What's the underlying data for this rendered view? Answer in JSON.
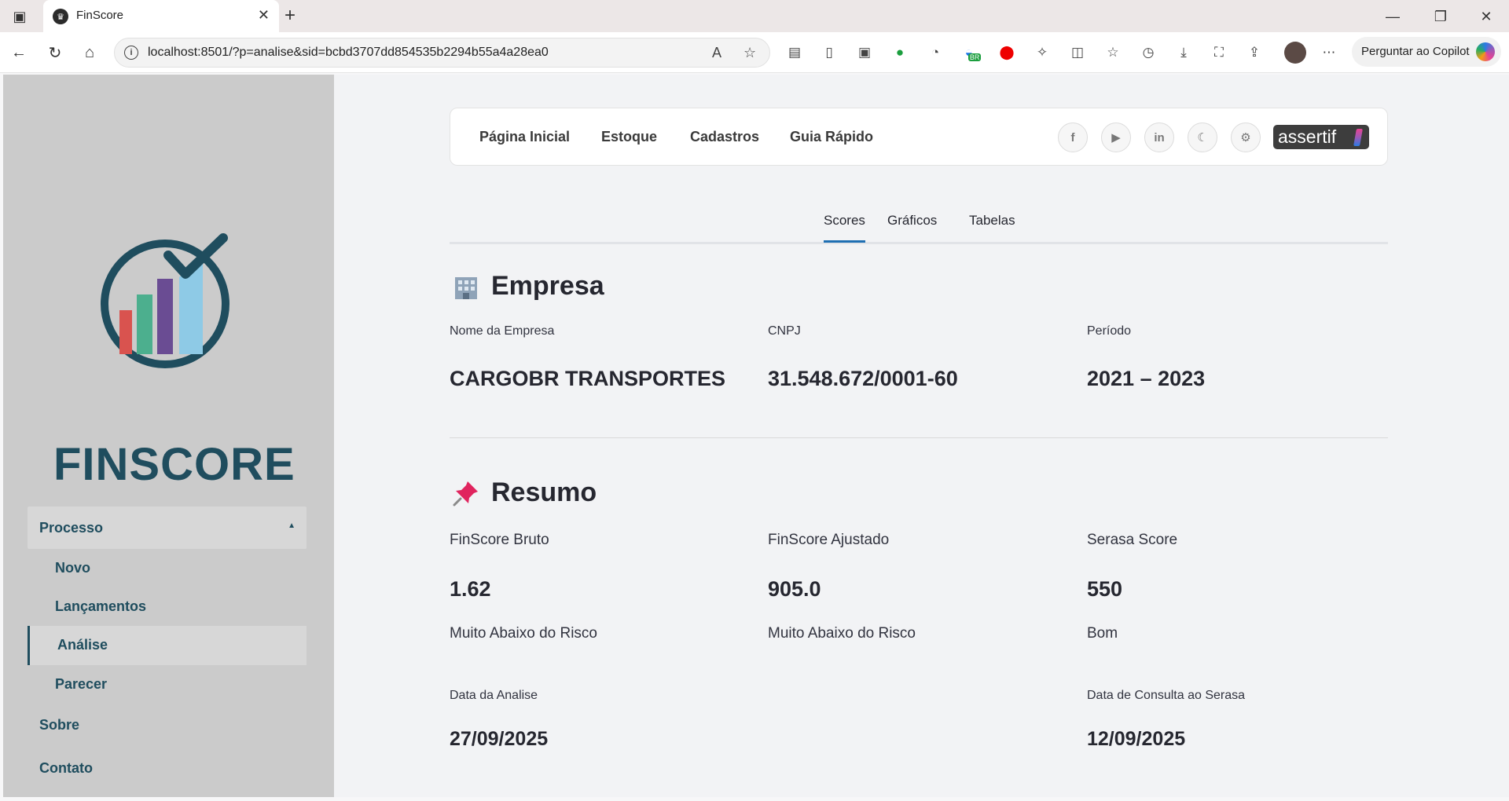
{
  "browser": {
    "tab_title": "FinScore",
    "url": "localhost:8501/?p=analise&sid=bcbd3707dd854535b2294b55a4a28ea0",
    "copilot_label": "Perguntar ao Copilot",
    "extension_badge": "BR"
  },
  "sidebar": {
    "logo_text": "FINSCORE",
    "group_label": "Processo",
    "sub_items": [
      "Novo",
      "Lançamentos",
      "Análise",
      "Parecer"
    ],
    "active_item": "Análise",
    "top_items": [
      "Sobre",
      "Contato"
    ],
    "logo_colors": {
      "ring": "#1f4d5e",
      "bar1": "#d9534f",
      "bar2": "#4caf8e",
      "bar3": "#6a4c93",
      "bar4": "#8ecae6"
    }
  },
  "topnav": {
    "links": [
      "Página Inicial",
      "Estoque",
      "Cadastros",
      "Guia Rápido"
    ],
    "icons": [
      "facebook-icon",
      "youtube-icon",
      "linkedin-icon",
      "moon-icon",
      "gear-icon"
    ],
    "brand": "assertif"
  },
  "tabs": {
    "items": [
      "Scores",
      "Gráficos",
      "Tabelas"
    ],
    "active": "Scores"
  },
  "empresa": {
    "title": "Empresa",
    "nome_label": "Nome da Empresa",
    "nome_value": "CARGOBR TRANSPORTES",
    "cnpj_label": "CNPJ",
    "cnpj_value": "31.548.672/0001-60",
    "periodo_label": "Período",
    "periodo_value": "2021 – 2023"
  },
  "resumo": {
    "title": "Resumo",
    "bruto_label": "FinScore Bruto",
    "bruto_value": "1.62",
    "bruto_class": "Muito Abaixo do Risco",
    "ajustado_label": "FinScore Ajustado",
    "ajustado_value": "905.0",
    "ajustado_class": "Muito Abaixo do Risco",
    "serasa_label": "Serasa Score",
    "serasa_value": "550",
    "serasa_class": "Bom",
    "data_analise_label": "Data da Analise",
    "data_analise_value": "27/09/2025",
    "data_serasa_label": "Data de Consulta ao Serasa",
    "data_serasa_value": "12/09/2025"
  },
  "colors": {
    "accent": "#1f4d5e",
    "tab_active": "#1f6fb2"
  }
}
